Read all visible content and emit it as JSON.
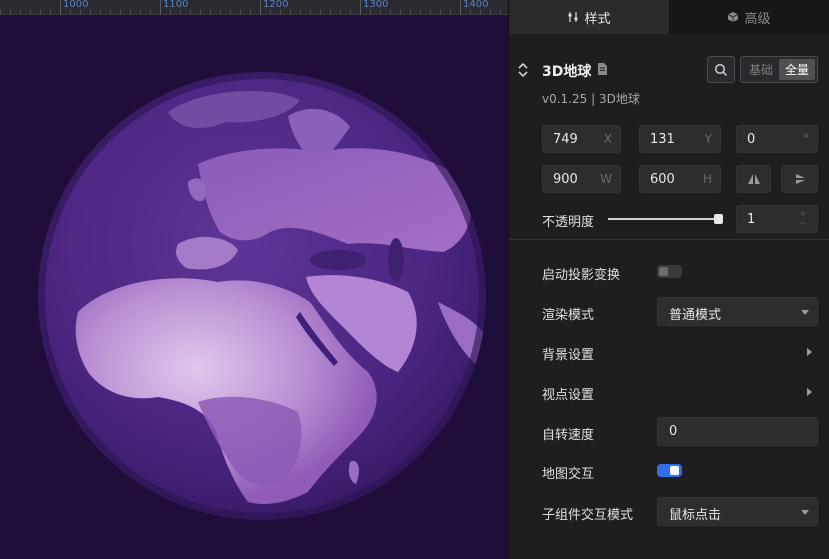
{
  "ruler": {
    "labels": [
      "1000",
      "1100",
      "1200",
      "1300",
      "1400"
    ]
  },
  "tabs": {
    "style": "样式",
    "advanced": "高级"
  },
  "component": {
    "title": "3D地球",
    "version": "v0.1.25 | 3D地球",
    "mode_basic": "基础",
    "mode_full": "全量"
  },
  "position": {
    "x": "749",
    "x_unit": "X",
    "y": "131",
    "y_unit": "Y",
    "rotation": "0",
    "rotation_unit": "°",
    "w": "900",
    "w_unit": "W",
    "h": "600",
    "h_unit": "H"
  },
  "opacity": {
    "label": "不透明度",
    "value": "1",
    "level": 1.0
  },
  "settings": {
    "projection_label": "启动投影变换",
    "projection_on": false,
    "render_label": "渲染模式",
    "render_value": "普通模式",
    "background_label": "背景设置",
    "viewpoint_label": "视点设置",
    "rotation_speed_label": "自转速度",
    "rotation_speed_value": "0",
    "map_interaction_label": "地图交互",
    "map_interaction_on": true,
    "child_interaction_label": "子组件交互模式",
    "child_interaction_value": "鼠标点击"
  },
  "colors": {
    "accent": "#2e6fe8",
    "canvas_bg": "#1f0e3a",
    "globe": "#5a2f8e"
  }
}
